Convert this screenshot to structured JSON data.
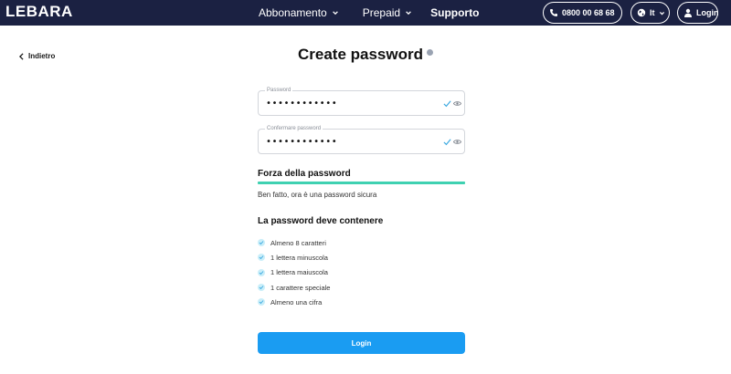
{
  "header": {
    "logo": "LEBARA",
    "nav": [
      {
        "label": "Abbonamento"
      },
      {
        "label": "Prepaid"
      },
      {
        "label": "Supporto"
      }
    ],
    "phone": "0800 00 68 68",
    "language": "It",
    "login": "Login"
  },
  "back_label": "Indietro",
  "page_title": "Create password",
  "form": {
    "password_label": "Password",
    "password_value": "••••••••••••",
    "confirm_label": "Confermare password",
    "confirm_value": "••••••••••••"
  },
  "strength": {
    "title": "Forza della password",
    "level": 1.0,
    "color": "#3fd1b1",
    "message": "Ben fatto, ora è una password sicura"
  },
  "requirements": {
    "title": "La password deve contenere",
    "items": [
      {
        "label": "Almeno 8 caratteri"
      },
      {
        "label": "1 lettera minuscola"
      },
      {
        "label": "1 lettera maiuscola"
      },
      {
        "label": "1 carattere speciale"
      },
      {
        "label": "Almeno una cifra"
      }
    ]
  },
  "submit_label": "Login",
  "colors": {
    "header_bg": "#1b2142",
    "accent": "#1a9cf2",
    "check": "#3aa8e0"
  }
}
